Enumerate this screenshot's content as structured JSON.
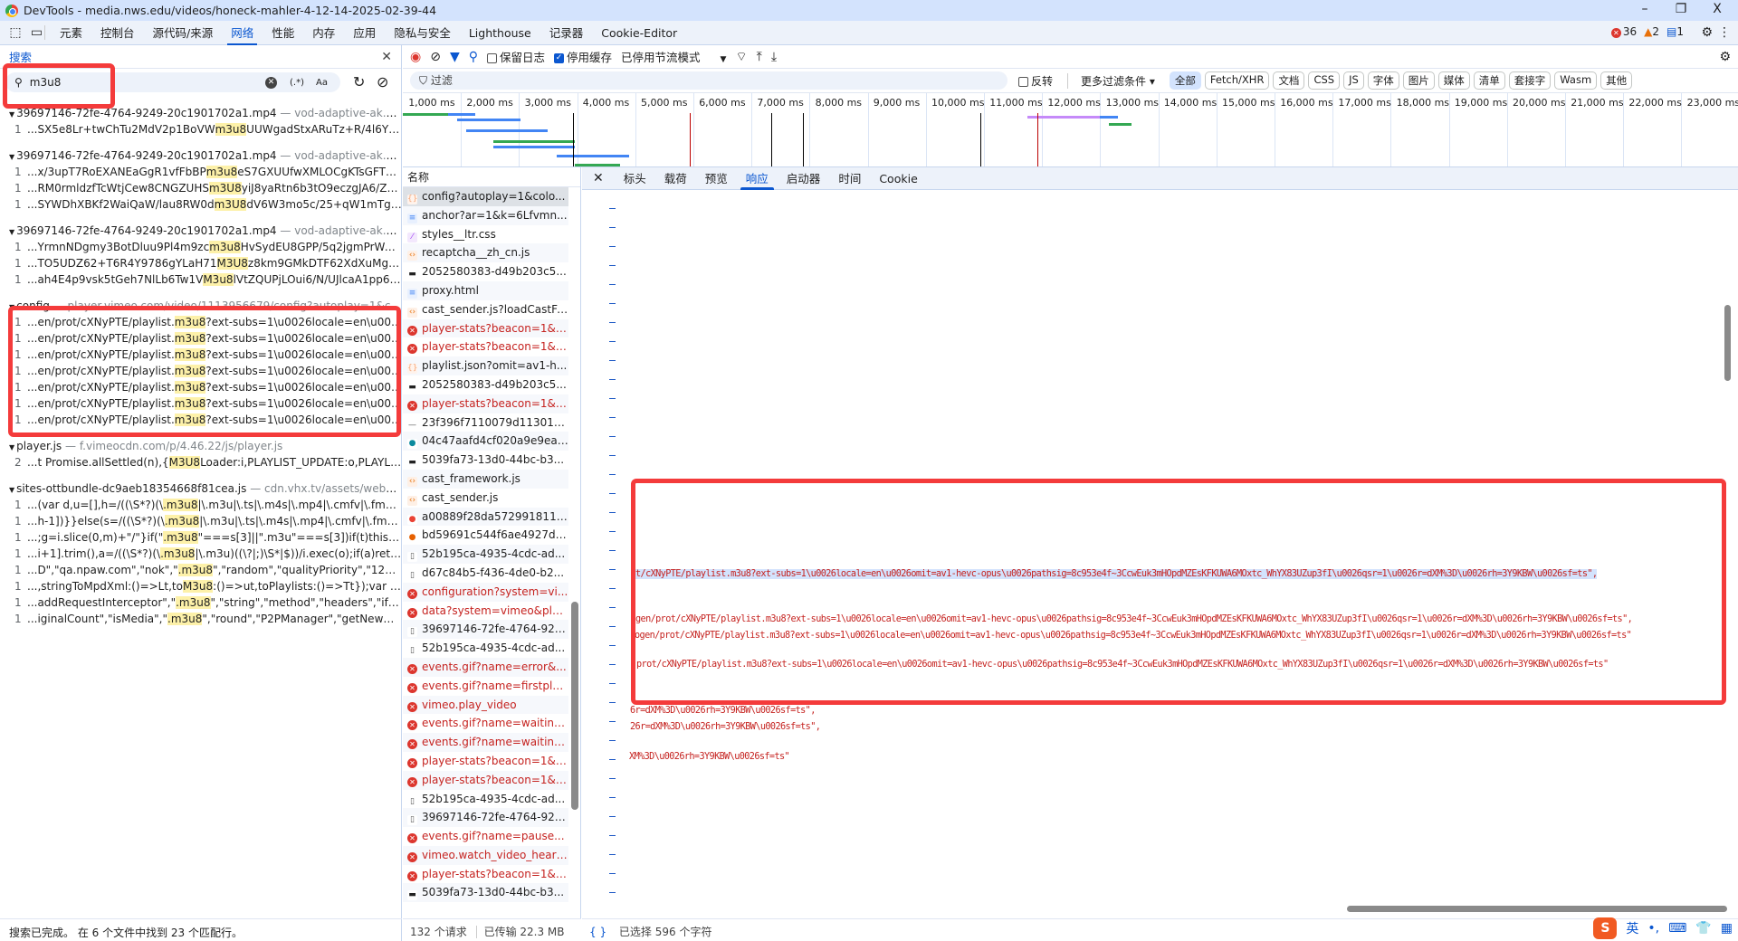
{
  "window": {
    "title": "DevTools - media.nws.edu/videos/honeck-mahler-4-12-14-2025-02-39-44",
    "minimize": "–",
    "maximize": "❐",
    "close": "X"
  },
  "tabs": [
    "元素",
    "控制台",
    "源代码/来源",
    "网络",
    "性能",
    "内存",
    "应用",
    "隐私与安全",
    "Lighthouse",
    "记录器",
    "Cookie-Editor"
  ],
  "issues": {
    "errors": "36",
    "warnings": "2",
    "info": "1"
  },
  "search": {
    "title": "搜索",
    "query": "m3u8",
    "regex": "(.*)",
    "case": "Aa",
    "groups": [
      {
        "file": "39697146-72fe-4764-9249-20c1901702a1.mp4",
        "url": "vod-adaptive-ak.vim...",
        "rows": [
          {
            "n": "1",
            "pre": "...SX5e8Lr+twChTu2MdV2p1BoVW",
            "m": "m3u8",
            "post": "UUWgadStxARuTz+R/4l6YFP..."
          }
        ]
      },
      {
        "file": "39697146-72fe-4764-9249-20c1901702a1.mp4",
        "url": "vod-adaptive-ak.vim...",
        "rows": [
          {
            "n": "1",
            "pre": "...x/3upT7RoEXANEaGgR1vfFbBP",
            "m": "m3u8",
            "post": "eS7GXUUfwXMLOCgKTsGFTGy..."
          },
          {
            "n": "1",
            "pre": "...RM0rmldzfTcWtjCew8CNGZUHS",
            "m": "m3U8",
            "post": "yiJ8yaRtn6b3tO9eczgJA6/Zm..."
          },
          {
            "n": "1",
            "pre": "...SYWDhXBKf2WaiQaW/lau8RW0d",
            "m": "m3U8",
            "post": "dV6W3mo5c/25+qW1mTgD..."
          }
        ]
      },
      {
        "file": "39697146-72fe-4764-9249-20c1901702a1.mp4",
        "url": "vod-adaptive-ak.vim...",
        "rows": [
          {
            "n": "1",
            "pre": "...YrmnNDgmy3BotDluu9Pl4m9zc",
            "m": "m3u8",
            "post": "HvSydEU8GPP/5q2jgmPrWAn..."
          },
          {
            "n": "1",
            "pre": "...TO5UDZ62+T6R4Y9786gYLaH71",
            "m": "M3U8",
            "post": "z8km9GMkDTF62XdXuMg+G..."
          },
          {
            "n": "1",
            "pre": "...ah4E4p9vsk5tGeh7NlLb6Tw1V",
            "m": "M3u8",
            "post": "lVtZQUPjLOui6/N/UJlcaA1pp64..."
          }
        ]
      },
      {
        "file": "config",
        "url": "player.vimeo.com/video/1113956679/config?autoplay=1&col...",
        "rows": [
          {
            "n": "1",
            "pre": "...en/prot/cXNyPTE/playlist.",
            "m": "m3u8",
            "post": "?ext-subs=1\\u0026locale=en\\u0026..."
          },
          {
            "n": "1",
            "pre": "...en/prot/cXNyPTE/playlist.",
            "m": "m3u8",
            "post": "?ext-subs=1\\u0026locale=en\\u0026..."
          },
          {
            "n": "1",
            "pre": "...en/prot/cXNyPTE/playlist.",
            "m": "m3u8",
            "post": "?ext-subs=1\\u0026locale=en\\u0026..."
          },
          {
            "n": "1",
            "pre": "...en/prot/cXNyPTE/playlist.",
            "m": "m3u8",
            "post": "?ext-subs=1\\u0026locale=en\\u0026..."
          },
          {
            "n": "1",
            "pre": "...en/prot/cXNyPTE/playlist.",
            "m": "m3u8",
            "post": "?ext-subs=1\\u0026locale=en\\u0026..."
          },
          {
            "n": "1",
            "pre": "...en/prot/cXNyPTE/playlist.",
            "m": "m3u8",
            "post": "?ext-subs=1\\u0026locale=en\\u0026..."
          },
          {
            "n": "1",
            "pre": "...en/prot/cXNyPTE/playlist.",
            "m": "m3u8",
            "post": "?ext-subs=1\\u0026locale=en\\u0026..."
          }
        ]
      },
      {
        "file": "player.js",
        "url": "f.vimeocdn.com/p/4.46.22/js/player.js",
        "rows": [
          {
            "n": "2",
            "pre": "...t Promise.allSettled(n),{",
            "m": "M3U8",
            "post": "Loader:i,PLAYLIST_UPDATE:o,PLAYLIST_..."
          }
        ]
      },
      {
        "file": "sites-ottbundle-dc9aeb18354668f81cea.js",
        "url": "cdn.vhx.tv/assets/webpack...",
        "rows": [
          {
            "n": "1",
            "pre": "...(var d,u=[],h=/((\\S*?)(\\",
            "m": ".m3u8",
            "post": "|\\.m3u|\\.ts|\\.m4s|\\.mp4|\\.cmfv|\\.fmp4)((\\..."
          },
          {
            "n": "1",
            "pre": "...h-1])}}else(s=/((\\S*?)(\\",
            "m": ".m3u8",
            "post": "|\\.m3u|\\.ts|\\.m4s|\\.mp4|\\.cmfv|\\.fmp4)((\\..."
          },
          {
            "n": "1",
            "pre": "...;g=i.slice(0,m)+\"/\"}if(\"",
            "m": ".m3u8",
            "post": "\"===s[3]||\".m3u\"===s[3])if(t)this._parse..."
          },
          {
            "n": "1",
            "pre": "...i+1].trim(),a=/((\\S*?)(\\",
            "m": ".m3u8",
            "post": "|\\.m3u)((\\?|;)\\S*|$))/i.exec(o);if(a)return a}..."
          },
          {
            "n": "1",
            "pre": "...D\",\"qa.npaw.com\",\"nok\",\"",
            "m": ".m3u8",
            "post": "\",\"random\",\"qualityPriority\",\"122830..."
          },
          {
            "n": "1",
            "pre": "...,stringToMpdXml:()=>Lt,to",
            "m": "M3u8",
            "post": ":()=>ut,toPlaylists:()=>Tt});var t=i(90..."
          },
          {
            "n": "1",
            "pre": "...addRequestInterceptor\",\"",
            "m": ".m3u8",
            "post": "\",\"string\",\"method\",\"headers\",\"ifByte..."
          },
          {
            "n": "1",
            "pre": "...iginalCount\",\"isMedia\",\"",
            "m": ".m3u8",
            "post": "\",\"round\",\"P2PManager\",\"getNewUrl\",..."
          }
        ]
      }
    ],
    "status": "搜索已完成。 在 6 个文件中找到 23 个匹配行。"
  },
  "toolbar": {
    "preserve_log": "保留日志",
    "disable_cache": "停用缓存",
    "throttle": "已停用节流模式"
  },
  "filter": {
    "placeholder": "过滤",
    "invert": "反转",
    "more": "更多过滤条件 ▾",
    "chips": [
      "全部",
      "Fetch/XHR",
      "文档",
      "CSS",
      "JS",
      "字体",
      "图片",
      "媒体",
      "清单",
      "套接字",
      "Wasm",
      "其他"
    ]
  },
  "timeline": {
    "ticks": [
      "1,000 ms",
      "2,000 ms",
      "3,000 ms",
      "4,000 ms",
      "5,000 ms",
      "6,000 ms",
      "7,000 ms",
      "8,000 ms",
      "9,000 ms",
      "10,000 ms",
      "11,000 ms",
      "12,000 ms",
      "13,000 ms",
      "14,000 ms",
      "15,000 ms",
      "16,000 ms",
      "17,000 ms",
      "18,000 ms",
      "19,000 ms",
      "20,000 ms",
      "21,000 ms",
      "22,000 ms",
      "23,000 ms"
    ]
  },
  "requests": {
    "header": "名称",
    "items": [
      {
        "name": "config?autoplay=1&colo...",
        "type": "json",
        "sel": true
      },
      {
        "name": "anchor?ar=1&k=6Lfvmn...",
        "type": "doc"
      },
      {
        "name": "styles__ltr.css",
        "type": "css"
      },
      {
        "name": "recaptcha__zh_cn.js",
        "type": "js"
      },
      {
        "name": "2052580383-d49b203c5...",
        "type": "img"
      },
      {
        "name": "proxy.html",
        "type": "doc"
      },
      {
        "name": "cast_sender.js?loadCastFr...",
        "type": "js"
      },
      {
        "name": "player-stats?beacon=1&s...",
        "type": "err"
      },
      {
        "name": "player-stats?beacon=1&s...",
        "type": "err"
      },
      {
        "name": "playlist.json?omit=av1-h...",
        "type": "json"
      },
      {
        "name": "2052580383-d49b203c5...",
        "type": "img"
      },
      {
        "name": "player-stats?beacon=1&s...",
        "type": "err"
      },
      {
        "name": "23f396f7110079d113019...",
        "type": "line"
      },
      {
        "name": "04c47aafd4cf020a9e9ea9...",
        "type": "edge"
      },
      {
        "name": "5039fa73-13d0-44bc-b3...",
        "type": "img"
      },
      {
        "name": "cast_framework.js",
        "type": "js"
      },
      {
        "name": "cast_sender.js",
        "type": "js"
      },
      {
        "name": "a00889f28da5729918118...",
        "type": "chrome"
      },
      {
        "name": "bd59691c544f6ae4927d6...",
        "type": "firefox"
      },
      {
        "name": "52b195ca-4935-4cdc-ad...",
        "type": "file"
      },
      {
        "name": "d67c84b5-f436-4de0-b2...",
        "type": "file"
      },
      {
        "name": "configuration?system=vi...",
        "type": "err"
      },
      {
        "name": "data?system=vimeo&plu...",
        "type": "err"
      },
      {
        "name": "39697146-72fe-4764-924...",
        "type": "file"
      },
      {
        "name": "52b195ca-4935-4cdc-ad...",
        "type": "file"
      },
      {
        "name": "events.gif?name=error&...",
        "type": "err"
      },
      {
        "name": "events.gif?name=firstpla...",
        "type": "err"
      },
      {
        "name": "vimeo.play_video",
        "type": "err"
      },
      {
        "name": "events.gif?name=waiting...",
        "type": "err"
      },
      {
        "name": "events.gif?name=waiting...",
        "type": "err"
      },
      {
        "name": "player-stats?beacon=1&s...",
        "type": "err"
      },
      {
        "name": "player-stats?beacon=1&s...",
        "type": "err"
      },
      {
        "name": "52b195ca-4935-4cdc-ad...",
        "type": "file"
      },
      {
        "name": "39697146-72fe-4764-924...",
        "type": "file"
      },
      {
        "name": "events.gif?name=pause...",
        "type": "err"
      },
      {
        "name": "vimeo.watch_video_heart...",
        "type": "err"
      },
      {
        "name": "player-stats?beacon=1&s...",
        "type": "err"
      },
      {
        "name": "5039fa73-13d0-44bc-b3...",
        "type": "img"
      }
    ],
    "count": "132 个请求",
    "transferred": "已传输 22.3 MB"
  },
  "detail": {
    "tabs": [
      "标头",
      "载荷",
      "预览",
      "响应",
      "启动器",
      "时间",
      "Cookie"
    ],
    "active": "响应",
    "lines": [
      "t/cXNyPTE/playlist.m3u8?ext-subs=1\\u0026locale=en\\u0026omit=av1-hevc-opus\\u0026pathsig=8c953e4f~3CcwEuk3mHOpdMZEsKFKUWA6MOxtc_WhYX83UZup3fI\\u0026qsr=1\\u0026r=dXM%3D\\u0026rh=3Y9KBW\\u0026sf=ts\",",
      "gen/prot/cXNyPTE/playlist.m3u8?ext-subs=1\\u0026locale=en\\u0026omit=av1-hevc-opus\\u0026pathsig=8c953e4f~3CcwEuk3mHOpdMZEsKFKUWA6MOxtc_WhYX83UZup3fI\\u0026qsr=1\\u0026r=dXM%3D\\u0026rh=3Y9KBW\\u0026sf=ts\",",
      "ogen/prot/cXNyPTE/playlist.m3u8?ext-subs=1\\u0026locale=en\\u0026omit=av1-hevc-opus\\u0026pathsig=8c953e4f~3CcwEuk3mHOpdMZEsKFKUWA6MOxtc_WhYX83UZup3fI\\u0026qsr=1\\u0026r=dXM%3D\\u0026rh=3Y9KBW\\u0026sf=ts\"",
      "prot/cXNyPTE/playlist.m3u8?ext-subs=1\\u0026locale=en\\u0026omit=av1-hevc-opus\\u0026pathsig=8c953e4f~3CcwEuk3mHOpdMZEsKFKUWA6MOxtc_WhYX83UZup3fI\\u0026qsr=1\\u0026r=dXM%3D\\u0026rh=3Y9KBW\\u0026sf=ts\"",
      "6r=dXM%3D\\u0026rh=3Y9KBW\\u0026sf=ts\",",
      "26r=dXM%3D\\u0026rh=3Y9KBW\\u0026sf=ts\",",
      "XM%3D\\u0026rh=3Y9KBW\\u0026sf=ts\""
    ],
    "status": "已选择 596 个字符"
  },
  "ime": {
    "lang": "英",
    "punct": "•,"
  }
}
